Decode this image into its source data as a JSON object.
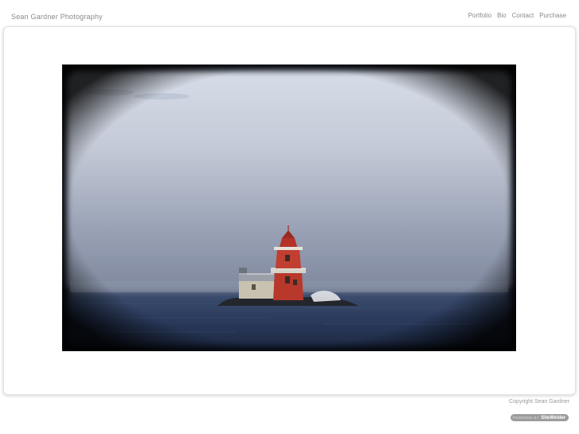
{
  "header": {
    "site_title": "Sean Gardner Photography"
  },
  "nav": {
    "items": [
      "Portfolio",
      "Bio",
      "Contact",
      "Purchase"
    ]
  },
  "footer": {
    "copyright": "Copyright Sean Gardner",
    "badge_prefix": "POWERED BY",
    "badge_brand": "SiteWelder"
  },
  "colors": {
    "text_gray": "#8a8a8a",
    "lighthouse_red": "#b8382c",
    "sea_blue": "#2a3c5e"
  },
  "icons": {
    "photo": "lighthouse-photo"
  }
}
